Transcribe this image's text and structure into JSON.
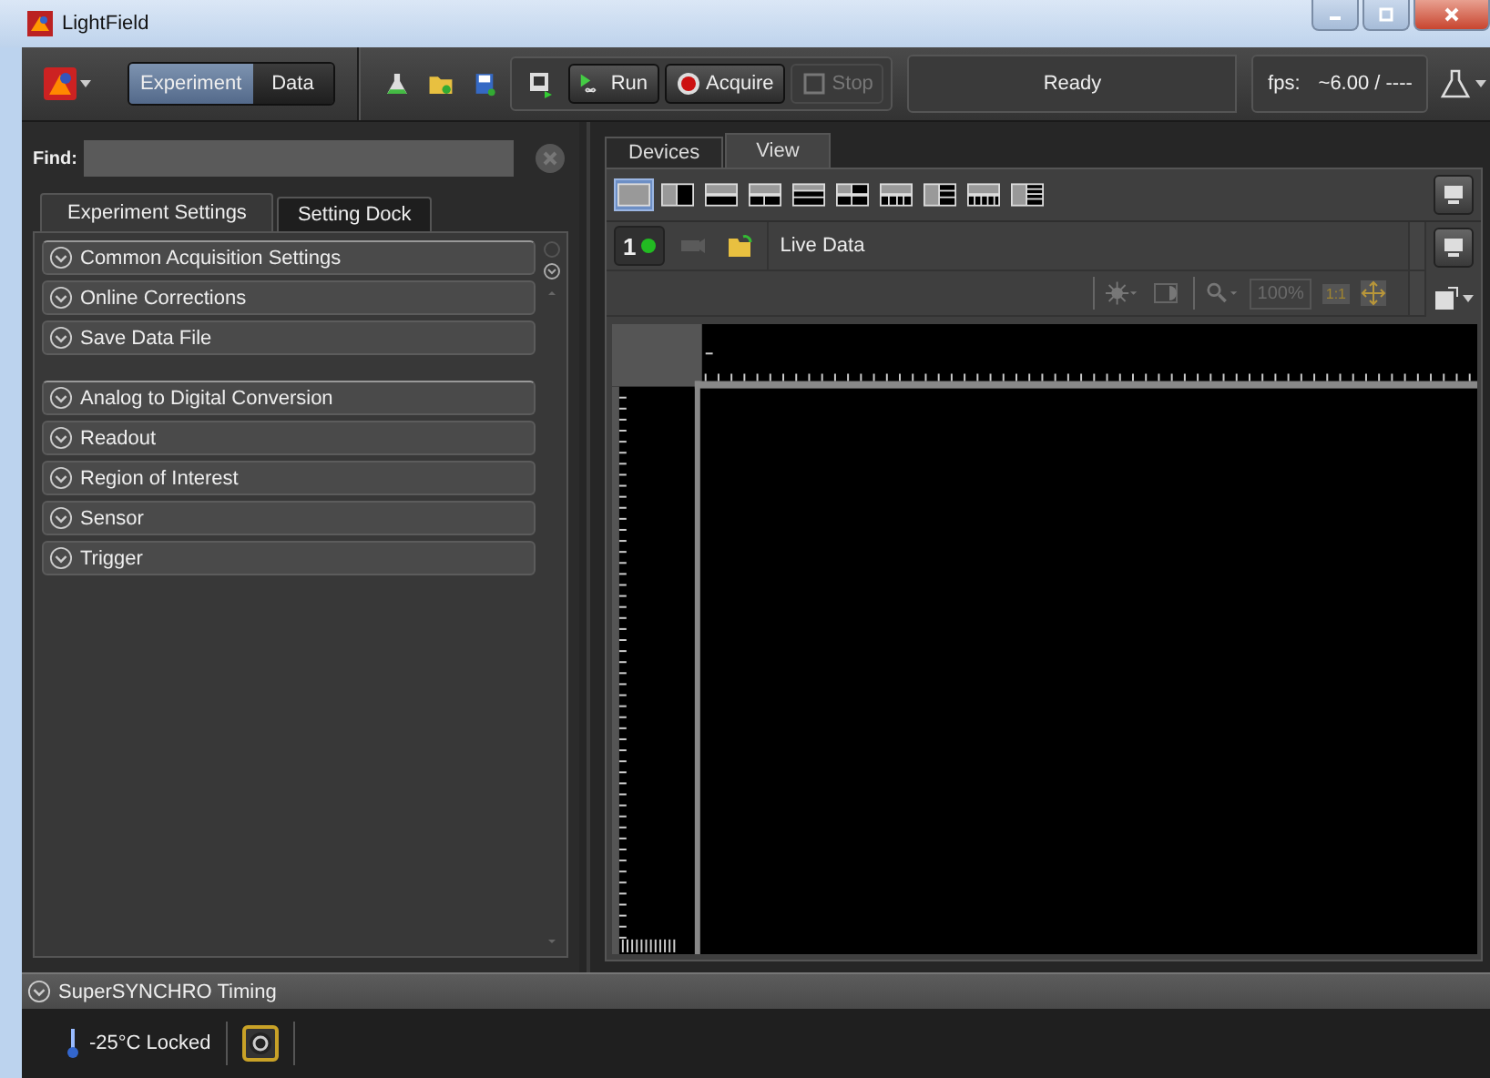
{
  "window": {
    "title": "LightField"
  },
  "mode_tabs": [
    {
      "label": "Experiment",
      "selected": true
    },
    {
      "label": "Data",
      "selected": false
    }
  ],
  "toolbar": {
    "run": "Run",
    "acquire": "Acquire",
    "stop": {
      "label": "Stop",
      "disabled": true
    },
    "status": "Ready",
    "fps_label": "fps:",
    "fps_value": "~6.00 / ----"
  },
  "find": {
    "label": "Find:"
  },
  "settings_tabs": [
    {
      "label": "Experiment Settings",
      "selected": true
    },
    {
      "label": "Setting Dock",
      "selected": false
    }
  ],
  "experiment_sections": [
    {
      "title": "Common Acquisition Settings"
    },
    {
      "title": "Online Corrections"
    },
    {
      "title": "Save Data File"
    }
  ],
  "device_sections": [
    {
      "title": "Analog to Digital Conversion"
    },
    {
      "title": "Readout"
    },
    {
      "title": "Region of Interest"
    },
    {
      "title": "Sensor"
    },
    {
      "title": "Trigger"
    }
  ],
  "view_tabs": [
    {
      "label": "Devices",
      "selected": false
    },
    {
      "label": "View",
      "selected": true
    }
  ],
  "layouts": [
    {
      "kind": "single",
      "selected": true
    },
    {
      "kind": "two-columns",
      "selected": false
    },
    {
      "kind": "two-rows",
      "selected": false
    },
    {
      "kind": "one-over-two",
      "selected": false
    },
    {
      "kind": "three-rows",
      "selected": false
    },
    {
      "kind": "four-grid",
      "selected": false
    },
    {
      "kind": "one-over-four",
      "selected": false
    },
    {
      "kind": "one-beside-three",
      "selected": false
    },
    {
      "kind": "one-over-five",
      "selected": false
    },
    {
      "kind": "one-beside-five",
      "selected": false
    }
  ],
  "viewer": {
    "number": "1",
    "title": "Live Data",
    "zoom": "100%",
    "one_to_one": "1:1"
  },
  "bottom_panel": {
    "title": "SuperSYNCHRO Timing"
  },
  "status": {
    "temperature": "-25°C Locked"
  }
}
